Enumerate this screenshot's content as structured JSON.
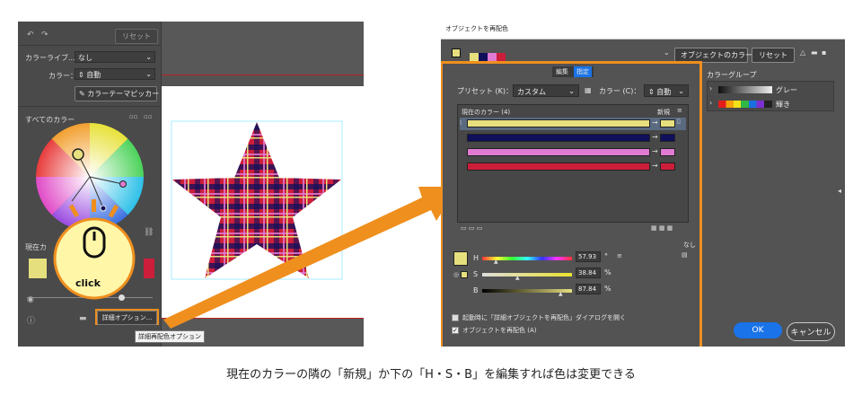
{
  "left_panel": {
    "toolbar_button": "リセット",
    "library_label": "カラーライブ...",
    "library_value": "なし",
    "color_label": "カラー：",
    "color_value": "自動",
    "picker_button": "カラーテーマピッカー",
    "all_colors_label": "すべてのカラー",
    "partial_label": "現在カ",
    "detail_button": "詳細オプション...",
    "tooltip": "詳細再配色オプション",
    "click_label": "click"
  },
  "dialog": {
    "title": "オブジェクトを再配色",
    "assign_objects_button": "オブジェクトのカラー",
    "reset_button": "リセット",
    "tab_edit": "編集",
    "tab_assign": "指定",
    "preset_label": "プリセット (K)：",
    "preset_value": "カスタム",
    "colors_label": "カラー (C)：",
    "colors_value": "自動",
    "current_colors_label": "現在のカラー (4)",
    "new_label": "新規",
    "color_groups_label": "カラーグループ",
    "group_gray": "グレー",
    "group_bright": "輝き",
    "none_label": "なし",
    "h_label": "H",
    "h_value": "57.93",
    "h_unit": "°",
    "s_label": "S",
    "s_value": "38.84",
    "s_unit": "%",
    "b_label": "B",
    "b_value": "87.84",
    "b_unit": "%",
    "checkbox_startup": "起動時に「詳細オブジェクトを再配色」ダイアログを開く",
    "checkbox_recolor": "オブジェクトを再配色 (A)",
    "ok_button": "OK",
    "cancel_button": "キャンセル"
  },
  "caption": "現在のカラーの隣の「新規」か下の「H・S・B」を編集すれば色は変更できる",
  "colors": {
    "accent_orange": "#ef8f1e",
    "swatch_yellow": "#e6df7e",
    "swatch_navy": "#0f0f5c",
    "swatch_pink": "#e07ad2",
    "swatch_red": "#cc1e3a",
    "ok_blue": "#1a73e8"
  }
}
